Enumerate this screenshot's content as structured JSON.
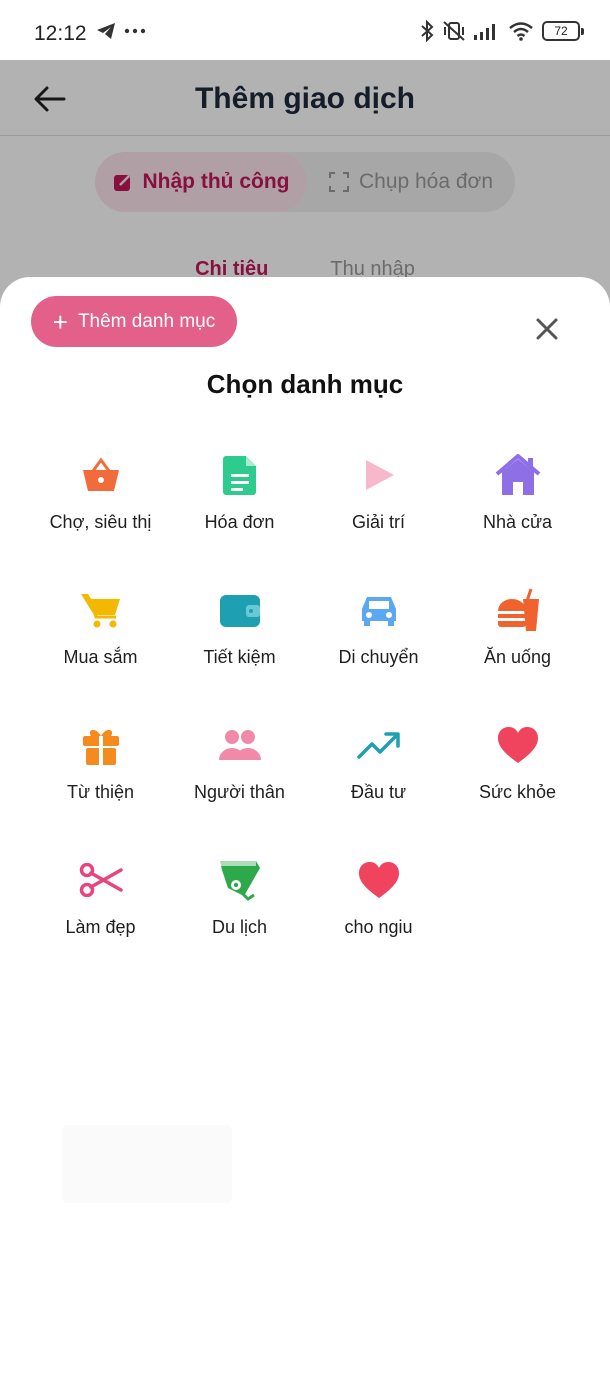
{
  "status_bar": {
    "time": "12:12",
    "battery": "72",
    "icons": [
      "telegram-icon",
      "more-dots-icon",
      "bluetooth-icon",
      "vibrate-off-icon",
      "signal-icon",
      "wifi-icon",
      "battery-icon"
    ]
  },
  "header": {
    "title": "Thêm giao dịch",
    "back_icon": "arrow-left-icon"
  },
  "mode_switch": {
    "manual": "Nhập thủ công",
    "scan": "Chụp hóa đơn"
  },
  "type_tabs": {
    "expense": "Chi tiêu",
    "income": "Thu nhập"
  },
  "sheet": {
    "add_button": "Thêm danh mục",
    "title": "Chọn danh mục",
    "categories": [
      {
        "label": "Chợ, siêu thị",
        "icon": "basket-icon",
        "color": "#F26B3A"
      },
      {
        "label": "Hóa đơn",
        "icon": "document-icon",
        "color": "#2ECB8E"
      },
      {
        "label": "Giải trí",
        "icon": "play-icon",
        "color": "#F7B8CB"
      },
      {
        "label": "Nhà cửa",
        "icon": "house-icon",
        "color": "#8E6FE6"
      },
      {
        "label": "Mua sắm",
        "icon": "cart-icon",
        "color": "#F5B800"
      },
      {
        "label": "Tiết kiệm",
        "icon": "wallet-icon",
        "color": "#1E9FB2"
      },
      {
        "label": "Di chuyển",
        "icon": "car-icon",
        "color": "#5AA8F2"
      },
      {
        "label": "Ăn uống",
        "icon": "burger-icon",
        "color": "#F0622E"
      },
      {
        "label": "Từ thiện",
        "icon": "gift-icon",
        "color": "#F58A1F"
      },
      {
        "label": "Người thân",
        "icon": "people-icon",
        "color": "#F08AA8"
      },
      {
        "label": "Đầu tư",
        "icon": "trend-up-icon",
        "color": "#1E9FB2"
      },
      {
        "label": "Sức khỏe",
        "icon": "heart-icon",
        "color": "#F0435E"
      },
      {
        "label": "Làm đẹp",
        "icon": "scissors-icon",
        "color": "#E8457E"
      },
      {
        "label": "Du lịch",
        "icon": "luggage-icon",
        "color": "#2DA84A"
      },
      {
        "label": "cho ngiu",
        "icon": "heart-icon",
        "color": "#F0435E"
      }
    ]
  }
}
